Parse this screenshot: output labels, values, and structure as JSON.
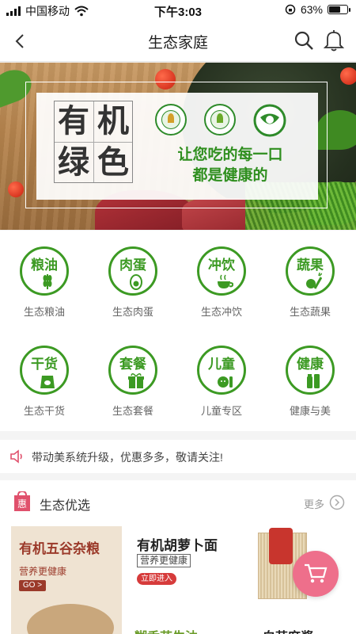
{
  "status_bar": {
    "carrier": "中国移动",
    "time": "下午3:03",
    "battery_percent": "63%",
    "battery_level": 0.63
  },
  "nav": {
    "title": "生态家庭",
    "back_icon": "chevron-left-icon",
    "search_icon": "search-icon",
    "bell_icon": "bell-icon"
  },
  "banner": {
    "big_chars": [
      "有",
      "机",
      "绿",
      "色"
    ],
    "slogan_line1": "让您吃的每一口",
    "slogan_line2": "都是健康的"
  },
  "categories": [
    {
      "badge": "粮油",
      "label": "生态粮油",
      "icon": "grain-icon"
    },
    {
      "badge": "肉蛋",
      "label": "生态肉蛋",
      "icon": "egg-icon"
    },
    {
      "badge": "冲饮",
      "label": "生态冲饮",
      "icon": "tea-cup-icon"
    },
    {
      "badge": "蔬果",
      "label": "生态蔬果",
      "icon": "vegetable-icon"
    },
    {
      "badge": "干货",
      "label": "生态干货",
      "icon": "dry-goods-bag-icon"
    },
    {
      "badge": "套餐",
      "label": "生态套餐",
      "icon": "gift-box-icon"
    },
    {
      "badge": "儿童",
      "label": "儿童专区",
      "icon": "child-icon"
    },
    {
      "badge": "健康",
      "label": "健康与美",
      "icon": "cosmetics-icon"
    }
  ],
  "notice": {
    "text": "带动美系统升级，优惠多多，敬请关注!",
    "icon": "speaker-icon"
  },
  "featured": {
    "badge_text": "惠",
    "title": "生态优选",
    "more_label": "更多",
    "products": {
      "a": {
        "title": "有机五谷杂粮",
        "subtitle": "营养更健康",
        "button": "GO >"
      },
      "b": {
        "title": "有机胡萝卜面",
        "subtitle": "营养更健康",
        "button": "立即进入"
      },
      "c": {
        "title": "糊香花生油"
      },
      "d": {
        "title": "白芸麻酱"
      }
    }
  },
  "colors": {
    "accent_green": "#3c9a23",
    "promo_red": "#d63b3b",
    "cart_pink": "#ee6f8b"
  }
}
